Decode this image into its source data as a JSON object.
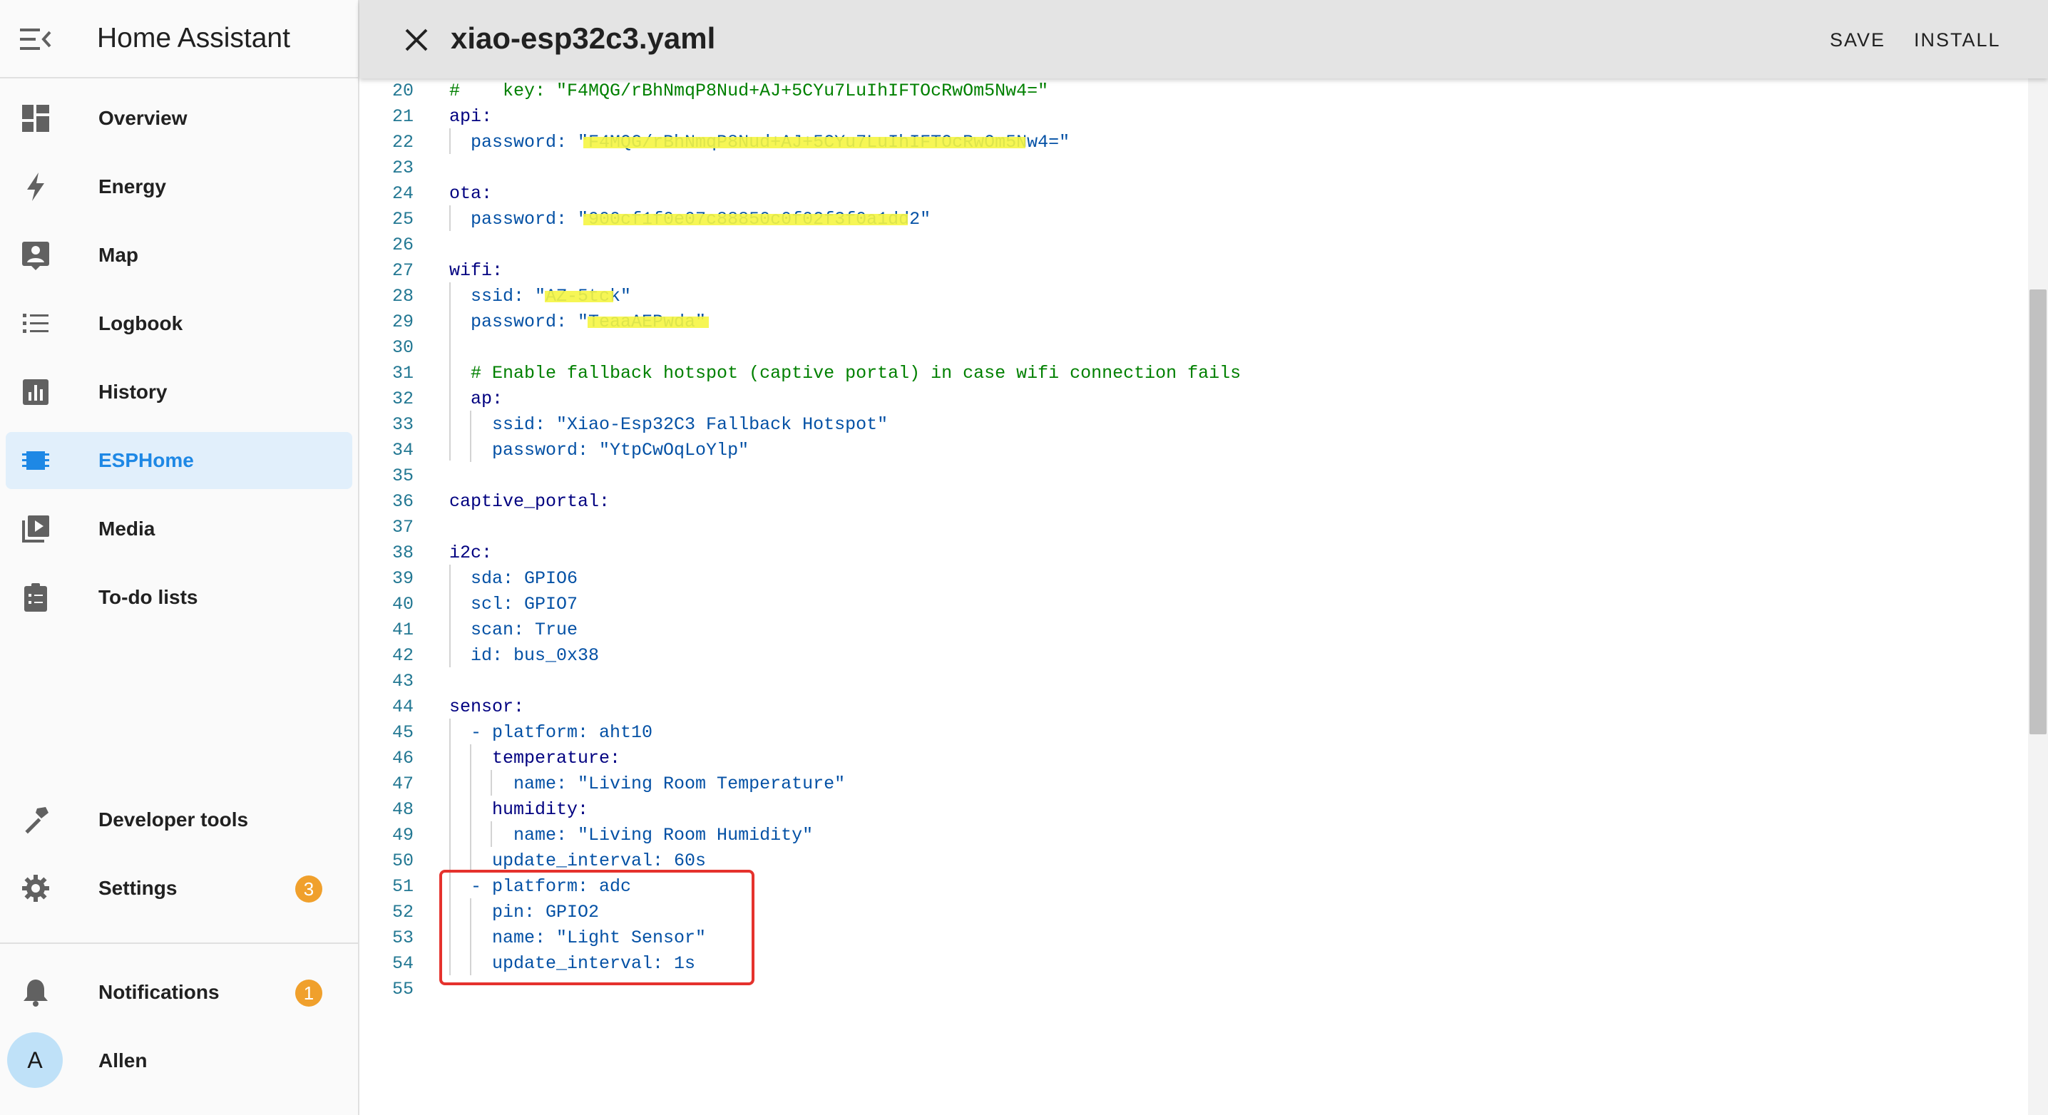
{
  "app": {
    "title": "Home Assistant"
  },
  "sidebar": {
    "items": [
      {
        "label": "Overview",
        "icon": "dashboard-icon",
        "active": false
      },
      {
        "label": "Energy",
        "icon": "lightning-bolt-icon",
        "active": false
      },
      {
        "label": "Map",
        "icon": "map-person-icon",
        "active": false
      },
      {
        "label": "Logbook",
        "icon": "list-icon",
        "active": false
      },
      {
        "label": "History",
        "icon": "chart-box-icon",
        "active": false
      },
      {
        "label": "ESPHome",
        "icon": "chip-icon",
        "active": true
      },
      {
        "label": "Media",
        "icon": "play-box-icon",
        "active": false
      },
      {
        "label": "To-do lists",
        "icon": "clipboard-list-icon",
        "active": false
      }
    ],
    "bottom_items": [
      {
        "label": "Developer tools",
        "icon": "hammer-icon"
      },
      {
        "label": "Settings",
        "icon": "gear-icon",
        "badge": "3"
      }
    ],
    "notifications": {
      "label": "Notifications",
      "icon": "bell-icon",
      "badge": "1"
    },
    "user": {
      "name": "Allen",
      "initial": "A"
    }
  },
  "editor_header": {
    "filename": "xiao-esp32c3.yaml",
    "save_label": "SAVE",
    "install_label": "INSTALL"
  },
  "colors": {
    "accent": "#1e88e5",
    "badge": "#f0a02c",
    "highlight_box": "#e5322d",
    "redaction": "#f5f542"
  },
  "code_lines": [
    {
      "n": "20",
      "text": "#    key: \"F4MQG/rBhNmqP8Nud+AJ+5CYu7LuIhIFTOcRwOm5Nw4=\""
    },
    {
      "n": "21",
      "text": "api:"
    },
    {
      "n": "22",
      "text": "  password: \"F4MQG/rBhNmqP8Nud+AJ+5CYu7LuIhIFTOcRwOm5Nw4=\""
    },
    {
      "n": "23",
      "text": ""
    },
    {
      "n": "24",
      "text": "ota:"
    },
    {
      "n": "25",
      "text": "  password: \"900cf1f0e07c88850c0f02f3f0a1dd2\""
    },
    {
      "n": "26",
      "text": ""
    },
    {
      "n": "27",
      "text": "wifi:"
    },
    {
      "n": "28",
      "text": "  ssid: \"AZ-5tck\""
    },
    {
      "n": "29",
      "text": "  password: \"TeaaAEPwda\""
    },
    {
      "n": "30",
      "text": ""
    },
    {
      "n": "31",
      "text": "  # Enable fallback hotspot (captive portal) in case wifi connection fails"
    },
    {
      "n": "32",
      "text": "  ap:"
    },
    {
      "n": "33",
      "text": "    ssid: \"Xiao-Esp32C3 Fallback Hotspot\""
    },
    {
      "n": "34",
      "text": "    password: \"YtpCwOqLoYlp\""
    },
    {
      "n": "35",
      "text": ""
    },
    {
      "n": "36",
      "text": "captive_portal:"
    },
    {
      "n": "37",
      "text": ""
    },
    {
      "n": "38",
      "text": "i2c:"
    },
    {
      "n": "39",
      "text": "  sda: GPIO6"
    },
    {
      "n": "40",
      "text": "  scl: GPIO7"
    },
    {
      "n": "41",
      "text": "  scan: True"
    },
    {
      "n": "42",
      "text": "  id: bus_0x38"
    },
    {
      "n": "43",
      "text": ""
    },
    {
      "n": "44",
      "text": "sensor:"
    },
    {
      "n": "45",
      "text": "  - platform: aht10"
    },
    {
      "n": "46",
      "text": "    temperature:"
    },
    {
      "n": "47",
      "text": "      name: \"Living Room Temperature\""
    },
    {
      "n": "48",
      "text": "    humidity:"
    },
    {
      "n": "49",
      "text": "      name: \"Living Room Humidity\""
    },
    {
      "n": "50",
      "text": "    update_interval: 60s"
    },
    {
      "n": "51",
      "text": "  - platform: adc"
    },
    {
      "n": "52",
      "text": "    pin: GPIO2"
    },
    {
      "n": "53",
      "text": "    name: \"Light Sensor\""
    },
    {
      "n": "54",
      "text": "    update_interval: 1s"
    },
    {
      "n": "55",
      "text": ""
    }
  ]
}
